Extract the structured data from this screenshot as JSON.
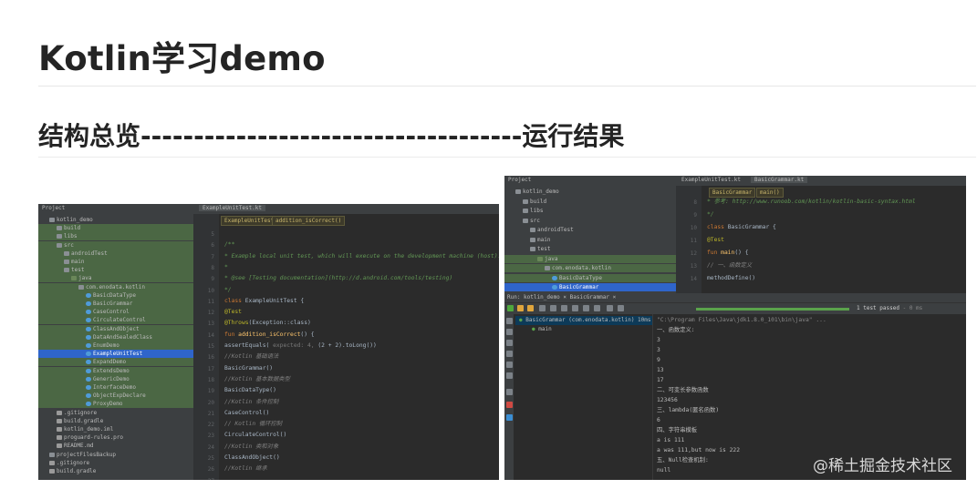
{
  "heading": "Kotlin学习demo",
  "subheading": "结构总览------------------------------------运行结果",
  "watermark": "@稀土掘金技术社区",
  "screenshot_left": {
    "project_label": "Project",
    "editor_tab": "ExampleUnitTest.kt",
    "breadcrumbs": [
      "ExampleUnitTest",
      "addition_isCorrect()"
    ],
    "tree": [
      {
        "label": "kotlin_demo",
        "depth": 1,
        "icon": "folder",
        "style": "plain"
      },
      {
        "label": "build",
        "depth": 2,
        "icon": "folder",
        "style": "hl"
      },
      {
        "label": "libs",
        "depth": 2,
        "icon": "folder",
        "style": "hl"
      },
      {
        "label": "src",
        "depth": 2,
        "icon": "folder",
        "style": "hl"
      },
      {
        "label": "androidTest",
        "depth": 3,
        "icon": "folder",
        "style": "hl"
      },
      {
        "label": "main",
        "depth": 3,
        "icon": "folder",
        "style": "hl"
      },
      {
        "label": "test",
        "depth": 3,
        "icon": "folder",
        "style": "hl"
      },
      {
        "label": "java",
        "depth": 4,
        "icon": "src",
        "style": "hl"
      },
      {
        "label": "com.enodata.kotlin",
        "depth": 5,
        "icon": "folder",
        "style": "hl"
      },
      {
        "label": "BasicDataType",
        "depth": 6,
        "icon": "kt",
        "style": "hl"
      },
      {
        "label": "BasicGrammar",
        "depth": 6,
        "icon": "kt",
        "style": "hl"
      },
      {
        "label": "CaseControl",
        "depth": 6,
        "icon": "kt",
        "style": "hl"
      },
      {
        "label": "CirculateControl",
        "depth": 6,
        "icon": "kt",
        "style": "hl"
      },
      {
        "label": "ClassAndObject",
        "depth": 6,
        "icon": "kt",
        "style": "hl"
      },
      {
        "label": "DataAndSealedClass",
        "depth": 6,
        "icon": "kt",
        "style": "hl"
      },
      {
        "label": "EnumDemo",
        "depth": 6,
        "icon": "kt",
        "style": "hl"
      },
      {
        "label": "ExampleUnitTest",
        "depth": 6,
        "icon": "kt",
        "style": "sel"
      },
      {
        "label": "ExpandDemo",
        "depth": 6,
        "icon": "kt",
        "style": "hl"
      },
      {
        "label": "ExtendsDemo",
        "depth": 6,
        "icon": "kt",
        "style": "hl"
      },
      {
        "label": "GenericDemo",
        "depth": 6,
        "icon": "kt",
        "style": "hl"
      },
      {
        "label": "InterfaceDemo",
        "depth": 6,
        "icon": "kt",
        "style": "hl"
      },
      {
        "label": "ObjectExpDeclare",
        "depth": 6,
        "icon": "kt",
        "style": "hl"
      },
      {
        "label": "ProxyDemo",
        "depth": 6,
        "icon": "kt",
        "style": "hl"
      },
      {
        "label": ".gitignore",
        "depth": 2,
        "icon": "file",
        "style": "plain"
      },
      {
        "label": "build.gradle",
        "depth": 2,
        "icon": "file",
        "style": "plain"
      },
      {
        "label": "kotlin_demo.iml",
        "depth": 2,
        "icon": "file",
        "style": "plain"
      },
      {
        "label": "proguard-rules.pro",
        "depth": 2,
        "icon": "file",
        "style": "plain"
      },
      {
        "label": "README.md",
        "depth": 2,
        "icon": "file",
        "style": "plain"
      },
      {
        "label": "projectFilesBackup",
        "depth": 1,
        "icon": "folder",
        "style": "plain"
      },
      {
        "label": ".gitignore",
        "depth": 1,
        "icon": "file",
        "style": "plain"
      },
      {
        "label": "build.gradle",
        "depth": 1,
        "icon": "file",
        "style": "plain"
      }
    ],
    "line_numbers": [
      "5",
      "6",
      "7",
      "8",
      "9",
      "10",
      "11",
      "12",
      "13",
      "14",
      "15",
      "16",
      "17",
      "18",
      "19",
      "20",
      "21",
      "22",
      "23",
      "24",
      "25",
      "26",
      "27"
    ],
    "code": [
      {
        "parts": [
          {
            "t": "",
            "c": "c-id"
          }
        ]
      },
      {
        "parts": [
          {
            "t": "/**",
            "c": "c-doc"
          }
        ]
      },
      {
        "parts": [
          {
            "t": " * Example local unit test, which will execute on the development machine (host).",
            "c": "c-doc"
          }
        ]
      },
      {
        "parts": [
          {
            "t": " *",
            "c": "c-doc"
          }
        ]
      },
      {
        "parts": [
          {
            "t": " * @see [Testing documentation](http://d.android.com/tools/testing)",
            "c": "c-doc"
          }
        ]
      },
      {
        "parts": [
          {
            "t": " */",
            "c": "c-doc"
          }
        ]
      },
      {
        "parts": [
          {
            "t": "class ",
            "c": "c-kw"
          },
          {
            "t": "ExampleUnitTest {",
            "c": "c-id"
          }
        ]
      },
      {
        "parts": [
          {
            "t": "    @Test",
            "c": "c-ann"
          }
        ]
      },
      {
        "parts": [
          {
            "t": "    @Throws",
            "c": "c-ann"
          },
          {
            "t": "(Exception::class)",
            "c": "c-id"
          }
        ]
      },
      {
        "parts": [
          {
            "t": "    fun ",
            "c": "c-kw"
          },
          {
            "t": "addition_isCorrect",
            "c": "c-fn"
          },
          {
            "t": "() {",
            "c": "c-id"
          }
        ]
      },
      {
        "parts": [
          {
            "t": "        assertEquals( ",
            "c": "c-id"
          },
          {
            "t": "expected: 4, ",
            "c": "c-hint"
          },
          {
            "t": "(2 + 2).toLong())",
            "c": "c-id"
          }
        ]
      },
      {
        "parts": [
          {
            "t": "        //Kotlin 基础语法",
            "c": "c-com"
          }
        ]
      },
      {
        "parts": [
          {
            "t": "        BasicGrammar()",
            "c": "c-id"
          }
        ]
      },
      {
        "parts": [
          {
            "t": "        //Kotlin 基本数据类型",
            "c": "c-com"
          }
        ]
      },
      {
        "parts": [
          {
            "t": "        BasicDataType()",
            "c": "c-id"
          }
        ]
      },
      {
        "parts": [
          {
            "t": "        //Kotlin 条件控制",
            "c": "c-com"
          }
        ]
      },
      {
        "parts": [
          {
            "t": "        CaseControl()",
            "c": "c-id"
          }
        ]
      },
      {
        "parts": [
          {
            "t": "        // Kotlin 循环控制",
            "c": "c-com"
          }
        ]
      },
      {
        "parts": [
          {
            "t": "        CirculateControl()",
            "c": "c-id"
          }
        ]
      },
      {
        "parts": [
          {
            "t": "        //Kotlin 类和对象",
            "c": "c-com"
          }
        ]
      },
      {
        "parts": [
          {
            "t": "        ClassAndObject()",
            "c": "c-id"
          }
        ]
      },
      {
        "parts": [
          {
            "t": "        //Kotlin 继承",
            "c": "c-com"
          }
        ]
      },
      {
        "parts": [
          {
            "t": "",
            "c": "c-id"
          }
        ]
      }
    ]
  },
  "screenshot_right": {
    "project_label": "Project",
    "editor_tabs": [
      "ExampleUnitTest.kt",
      "BasicGrammar.kt"
    ],
    "breadcrumbs": [
      "BasicGrammar",
      "main()"
    ],
    "tree": [
      {
        "label": "kotlin_demo",
        "depth": 1,
        "icon": "folder",
        "style": "plain"
      },
      {
        "label": "build",
        "depth": 2,
        "icon": "folder",
        "style": "plain"
      },
      {
        "label": "libs",
        "depth": 2,
        "icon": "folder",
        "style": "plain"
      },
      {
        "label": "src",
        "depth": 2,
        "icon": "folder",
        "style": "plain"
      },
      {
        "label": "androidTest",
        "depth": 3,
        "icon": "folder",
        "style": "plain"
      },
      {
        "label": "main",
        "depth": 3,
        "icon": "folder",
        "style": "plain"
      },
      {
        "label": "test",
        "depth": 3,
        "icon": "folder",
        "style": "plain"
      },
      {
        "label": "java",
        "depth": 4,
        "icon": "src",
        "style": "hl"
      },
      {
        "label": "com.enodata.kotlin",
        "depth": 5,
        "icon": "folder",
        "style": "hl"
      },
      {
        "label": "BasicDataType",
        "depth": 6,
        "icon": "kt",
        "style": "hl"
      },
      {
        "label": "BasicGrammar",
        "depth": 6,
        "icon": "kt",
        "style": "sel"
      }
    ],
    "line_numbers": [
      "8",
      "9",
      "10",
      "11",
      "12",
      "13",
      "14"
    ],
    "code": [
      {
        "parts": [
          {
            "t": " * 参考: http://www.runoob.com/kotlin/kotlin-basic-syntax.html",
            "c": "c-doc"
          }
        ]
      },
      {
        "parts": [
          {
            "t": " */",
            "c": "c-doc"
          }
        ]
      },
      {
        "parts": [
          {
            "t": "class ",
            "c": "c-kw"
          },
          {
            "t": "BasicGrammar {",
            "c": "c-id"
          }
        ]
      },
      {
        "parts": [
          {
            "t": "    @Test",
            "c": "c-ann"
          }
        ]
      },
      {
        "parts": [
          {
            "t": "    fun ",
            "c": "c-kw"
          },
          {
            "t": "main",
            "c": "c-fn"
          },
          {
            "t": "() {",
            "c": "c-id"
          }
        ]
      },
      {
        "parts": [
          {
            "t": "        // 一、函数定义",
            "c": "c-com"
          }
        ]
      },
      {
        "parts": [
          {
            "t": "        methodDefine()",
            "c": "c-id"
          }
        ]
      }
    ],
    "run": {
      "tabs_text": "Run:   kotlin_demo  ×    BasicGrammar  ×",
      "status": "1 test passed",
      "time": "- 0 ms",
      "tree": [
        {
          "label": "BasicGrammar (com.enodata.kotlin)  10ms",
          "sel": true
        },
        {
          "label": "main",
          "sel": false
        }
      ],
      "console": [
        "\"C:\\Program Files\\Java\\jdk1.8.0_101\\bin\\java\" ...",
        "一、函数定义:",
        "3",
        "3",
        "9",
        "13",
        "17",
        "二、可变长参数函数",
        "123456",
        "三、lambda(匿名函数)",
        "6",
        "四、字符串模板",
        "a is 111",
        "a was 111,but now is 222",
        "五、Null检查机制:",
        "null"
      ]
    }
  }
}
